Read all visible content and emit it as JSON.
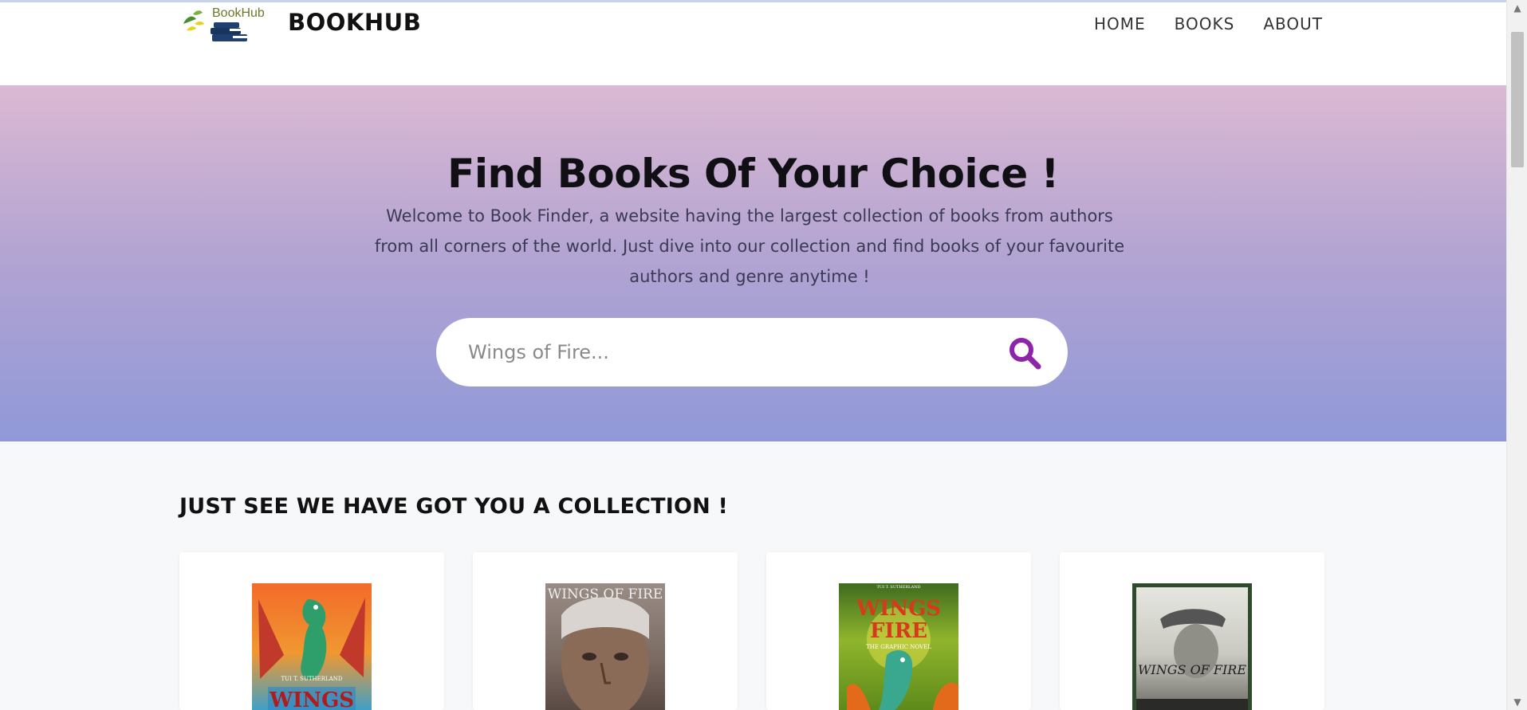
{
  "header": {
    "logo_text": "BookHub",
    "brand": "BOOKHUB",
    "nav": [
      {
        "label": "HOME"
      },
      {
        "label": "BOOKS"
      },
      {
        "label": "ABOUT"
      }
    ]
  },
  "hero": {
    "title": "Find Books Of Your Choice !",
    "subtitle": "Welcome to Book Finder, a website having the largest collection of books from authors from all corners of the world. Just dive into our collection and find books of your favourite authors and genre anytime !",
    "search": {
      "placeholder": "Wings of Fire...",
      "icon": "search-icon"
    }
  },
  "collection": {
    "title": "JUST SEE WE HAVE GOT YOU A COLLECTION !",
    "books": [
      {
        "cover_text": "WINGS",
        "author_text": "TUI T. SUTHERLAND"
      },
      {
        "cover_text": "WINGS OF FIRE",
        "author_text": ""
      },
      {
        "cover_text": "WINGS FIRE",
        "author_text": "TUI T. SUTHERLAND",
        "subtitle_text": "THE GRAPHIC NOVEL"
      },
      {
        "cover_text": "WINGS OF FIRE",
        "author_text": ""
      }
    ]
  },
  "colors": {
    "accent": "#8e24aa",
    "hero_top": "#dbb9d3",
    "hero_bottom": "#9099d8"
  }
}
